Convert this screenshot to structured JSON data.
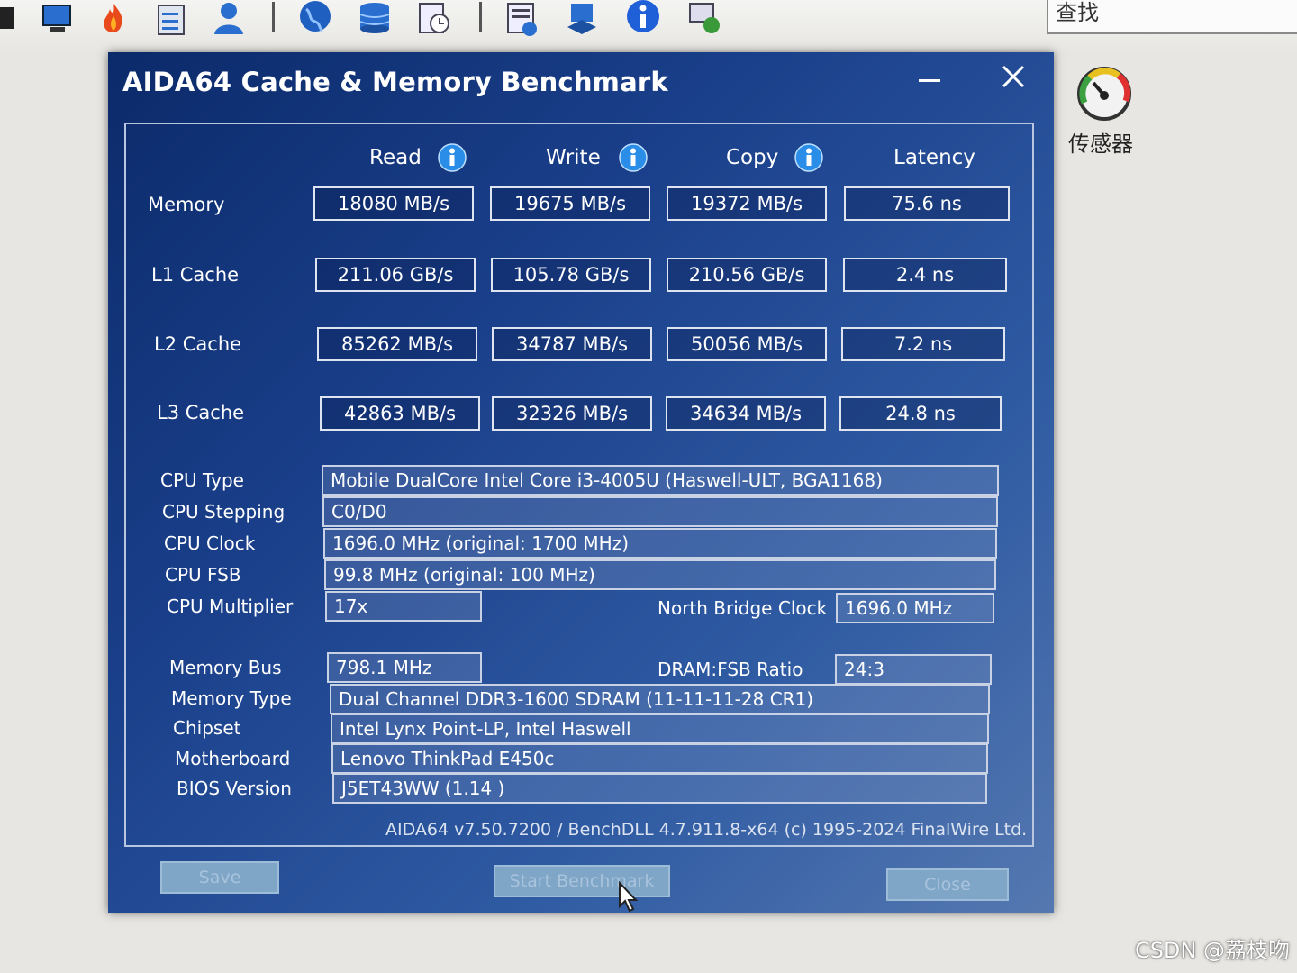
{
  "toolbar": {
    "search_label": "查找",
    "sensor_label": "传感器"
  },
  "dialog": {
    "title": "AIDA64 Cache & Memory Benchmark",
    "columns": [
      "Read",
      "Write",
      "Copy",
      "Latency"
    ],
    "rows": [
      {
        "label": "Memory",
        "values": [
          "18080 MB/s",
          "19675 MB/s",
          "19372 MB/s",
          "75.6 ns"
        ]
      },
      {
        "label": "L1 Cache",
        "values": [
          "211.06 GB/s",
          "105.78 GB/s",
          "210.56 GB/s",
          "2.4 ns"
        ]
      },
      {
        "label": "L2 Cache",
        "values": [
          "85262 MB/s",
          "34787 MB/s",
          "50056 MB/s",
          "7.2 ns"
        ]
      },
      {
        "label": "L3 Cache",
        "values": [
          "42863 MB/s",
          "32326 MB/s",
          "34634 MB/s",
          "24.8 ns"
        ]
      }
    ],
    "info": {
      "cpu_type_label": "CPU Type",
      "cpu_type": "Mobile DualCore Intel Core i3-4005U  (Haswell-ULT, BGA1168)",
      "cpu_stepping_label": "CPU Stepping",
      "cpu_stepping": "C0/D0",
      "cpu_clock_label": "CPU Clock",
      "cpu_clock": "1696.0 MHz  (original: 1700 MHz)",
      "cpu_fsb_label": "CPU FSB",
      "cpu_fsb": "99.8 MHz  (original: 100 MHz)",
      "cpu_multiplier_label": "CPU Multiplier",
      "cpu_multiplier": "17x",
      "nb_clock_label": "North Bridge Clock",
      "nb_clock": "1696.0 MHz",
      "memory_bus_label": "Memory Bus",
      "memory_bus": "798.1 MHz",
      "dram_fsb_label": "DRAM:FSB Ratio",
      "dram_fsb": "24:3",
      "memory_type_label": "Memory Type",
      "memory_type": "Dual Channel DDR3-1600 SDRAM  (11-11-11-28 CR1)",
      "chipset_label": "Chipset",
      "chipset": "Intel Lynx Point-LP, Intel Haswell",
      "motherboard_label": "Motherboard",
      "motherboard": "Lenovo ThinkPad E450c",
      "bios_label": "BIOS Version",
      "bios": "J5ET43WW (1.14 )"
    },
    "footer": "AIDA64 v7.50.7200 / BenchDLL 4.7.911.8-x64  (c) 1995-2024 FinalWire Ltd.",
    "buttons": {
      "save": "Save",
      "start": "Start Benchmark",
      "close": "Close"
    }
  },
  "watermark": "CSDN @荔枝吻",
  "colors": {
    "dialog_bg": "#1a3f8a",
    "info_icon": "#2a8ee8",
    "button_bg": "#7fa5c7"
  }
}
